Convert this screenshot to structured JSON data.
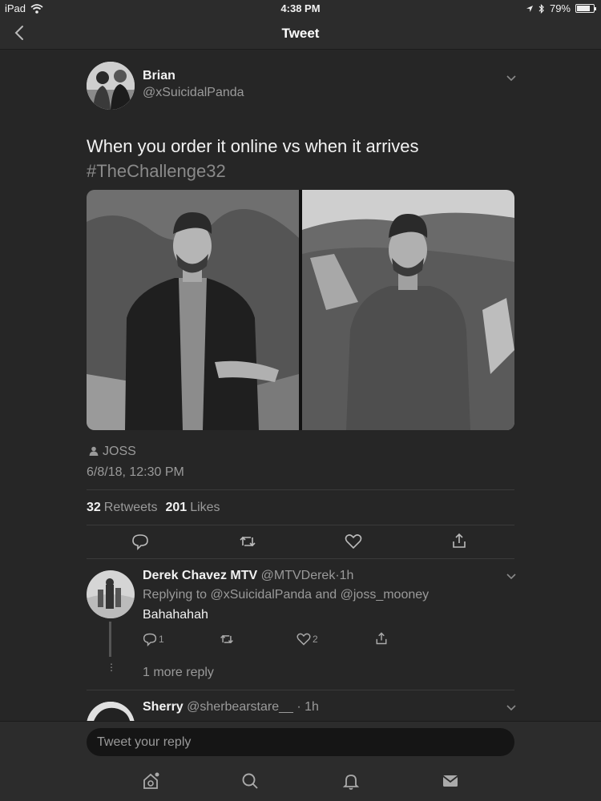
{
  "status_bar": {
    "device": "iPad",
    "time": "4:38 PM",
    "battery": "79%",
    "battery_level": 0.79
  },
  "nav": {
    "title": "Tweet"
  },
  "tweet": {
    "author_name": "Brian",
    "author_handle": "@xSuicidalPanda",
    "text": "When you order it online vs when it arrives",
    "hashtag": "#TheChallenge32",
    "tagged_user": "JOSS",
    "timestamp": "6/8/18, 12:30 PM",
    "retweets_count": "32",
    "retweets_label": "Retweets",
    "likes_count": "201",
    "likes_label": "Likes"
  },
  "replies": [
    {
      "name": "Derek Chavez MTV",
      "handle": "@MTVDerek",
      "time": "1h",
      "replying_prefix": "Replying to",
      "replying_to": "@xSuicidalPanda and @joss_mooney",
      "text": "Bahahahah",
      "reply_count": "1",
      "like_count": "2",
      "more_replies": "1 more reply"
    },
    {
      "name": "Sherry",
      "handle": "@sherbearstare__",
      "time": "1h"
    }
  ],
  "composer": {
    "placeholder": "Tweet your reply"
  },
  "tabs": [
    "home-icon",
    "search-icon",
    "notifications-icon",
    "messages-icon"
  ],
  "colors": {
    "background": "#262626",
    "bar": "#2c2c2c",
    "text": "#f2f2f2",
    "muted": "#9a9a9a"
  }
}
